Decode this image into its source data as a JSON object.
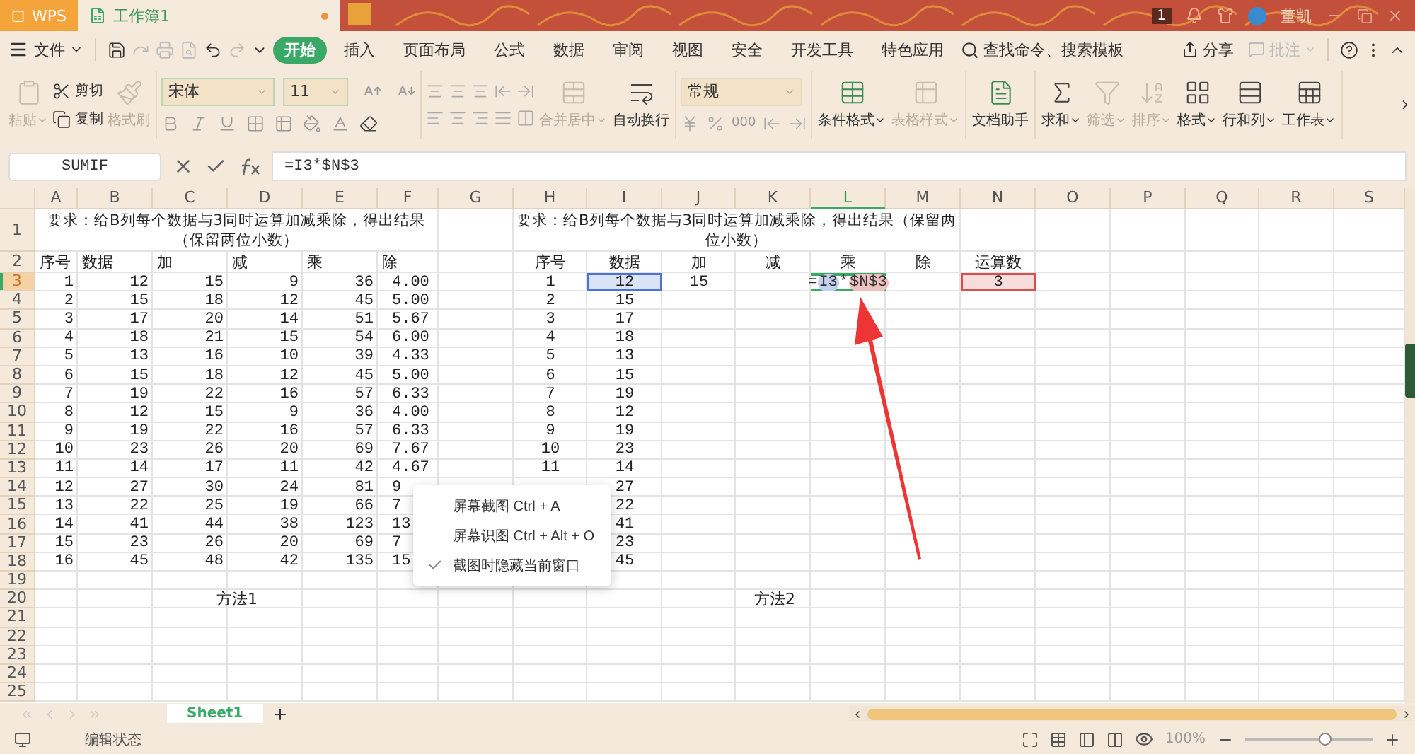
{
  "title_bar": {
    "tabs": [
      {
        "label": "WPS",
        "kind": "home",
        "selected": false
      },
      {
        "label": "工作簿1",
        "kind": "doc",
        "selected": true
      }
    ],
    "badge": "1",
    "user": "董凯"
  },
  "menu": {
    "file": "文件",
    "tabs": [
      {
        "label": "开始",
        "selected": true
      },
      {
        "label": "插入",
        "selected": false
      },
      {
        "label": "页面布局",
        "selected": false
      },
      {
        "label": "公式",
        "selected": false
      },
      {
        "label": "数据",
        "selected": false
      },
      {
        "label": "审阅",
        "selected": false
      },
      {
        "label": "视图",
        "selected": false
      },
      {
        "label": "安全",
        "selected": false
      },
      {
        "label": "开发工具",
        "selected": false
      },
      {
        "label": "特色应用",
        "selected": false
      }
    ],
    "search": "查找命令、搜索模板",
    "share": "分享",
    "comment": {
      "label": "批注",
      "disabled": true
    }
  },
  "ribbon": {
    "groups": [
      [
        {
          "kind": "large",
          "label": "粘贴",
          "dropdown": true,
          "disabled": true
        },
        {
          "kind": "stack",
          "items": [
            {
              "label": "剪切",
              "disabled": false
            },
            {
              "label": "复制",
              "disabled": false
            }
          ]
        },
        {
          "kind": "large",
          "label": "格式刷",
          "dropdown": false,
          "disabled": true
        }
      ],
      [
        {
          "kind": "font",
          "font": "宋体",
          "size": "11"
        }
      ],
      [
        {
          "kind": "align"
        },
        {
          "kind": "large",
          "label": "合并居中",
          "dropdown": true,
          "disabled": true
        },
        {
          "kind": "large",
          "label": "自动换行",
          "dropdown": false,
          "disabled": false
        }
      ],
      [
        {
          "kind": "number",
          "format": "常规",
          "thousands": "000"
        }
      ],
      [
        {
          "kind": "large",
          "label": "条件格式",
          "dropdown": true,
          "disabled": false
        },
        {
          "kind": "large",
          "label": "表格样式",
          "dropdown": true,
          "disabled": true
        }
      ],
      [
        {
          "kind": "large",
          "label": "文档助手",
          "dropdown": false,
          "disabled": false
        }
      ],
      [
        {
          "kind": "large",
          "label": "求和",
          "dropdown": true,
          "disabled": false
        },
        {
          "kind": "large",
          "label": "筛选",
          "dropdown": true,
          "disabled": true
        },
        {
          "kind": "large",
          "label": "排序",
          "dropdown": true,
          "disabled": true
        },
        {
          "kind": "large",
          "label": "格式",
          "dropdown": true,
          "disabled": false
        },
        {
          "kind": "large",
          "label": "行和列",
          "dropdown": true,
          "disabled": false
        },
        {
          "kind": "large",
          "label": "工作表",
          "dropdown": true,
          "disabled": false
        }
      ]
    ]
  },
  "formula_bar": {
    "name_box": "SUMIF",
    "formula": "=I3*$N$3"
  },
  "sheet": {
    "columns": [
      {
        "label": "A",
        "selected": false
      },
      {
        "label": "B",
        "selected": false
      },
      {
        "label": "C",
        "selected": false
      },
      {
        "label": "D",
        "selected": false
      },
      {
        "label": "E",
        "selected": false
      },
      {
        "label": "F",
        "selected": false
      },
      {
        "label": "G",
        "selected": false
      },
      {
        "label": "H",
        "selected": false
      },
      {
        "label": "I",
        "selected": false
      },
      {
        "label": "J",
        "selected": false
      },
      {
        "label": "K",
        "selected": false
      },
      {
        "label": "L",
        "selected": true
      },
      {
        "label": "M",
        "selected": false
      },
      {
        "label": "N",
        "selected": false
      },
      {
        "label": "O",
        "selected": false
      },
      {
        "label": "P",
        "selected": false
      },
      {
        "label": "Q",
        "selected": false
      },
      {
        "label": "R",
        "selected": false
      },
      {
        "label": "S",
        "selected": false
      }
    ],
    "row_numbers": [
      {
        "label": "1",
        "selected": false
      },
      {
        "label": "2",
        "selected": false
      },
      {
        "label": "3",
        "selected": true
      },
      {
        "label": "4",
        "selected": false
      },
      {
        "label": "5",
        "selected": false
      },
      {
        "label": "6",
        "selected": false
      },
      {
        "label": "7",
        "selected": false
      },
      {
        "label": "8",
        "selected": false
      },
      {
        "label": "9",
        "selected": false
      },
      {
        "label": "10",
        "selected": false
      },
      {
        "label": "11",
        "selected": false
      },
      {
        "label": "12",
        "selected": false
      },
      {
        "label": "13",
        "selected": false
      },
      {
        "label": "14",
        "selected": false
      },
      {
        "label": "15",
        "selected": false
      },
      {
        "label": "16",
        "selected": false
      },
      {
        "label": "17",
        "selected": false
      },
      {
        "label": "18",
        "selected": false
      },
      {
        "label": "19",
        "selected": false
      },
      {
        "label": "20",
        "selected": false
      },
      {
        "label": "21",
        "selected": false
      },
      {
        "label": "22",
        "selected": false
      },
      {
        "label": "23",
        "selected": false
      },
      {
        "label": "24",
        "selected": false
      },
      {
        "label": "25",
        "selected": false
      }
    ],
    "left_table": {
      "title": "要求：给B列每个数据与3同时运算加减乘除，得出结果（保留两位小数）",
      "headers": [
        "序号",
        "数据",
        "加",
        "减",
        "乘",
        "除"
      ],
      "rows": [
        [
          "1",
          "12",
          "15",
          "9",
          "36",
          "4.00"
        ],
        [
          "2",
          "15",
          "18",
          "12",
          "45",
          "5.00"
        ],
        [
          "3",
          "17",
          "20",
          "14",
          "51",
          "5.67"
        ],
        [
          "4",
          "18",
          "21",
          "15",
          "54",
          "6.00"
        ],
        [
          "5",
          "13",
          "16",
          "10",
          "39",
          "4.33"
        ],
        [
          "6",
          "15",
          "18",
          "12",
          "45",
          "5.00"
        ],
        [
          "7",
          "19",
          "22",
          "16",
          "57",
          "6.33"
        ],
        [
          "8",
          "12",
          "15",
          "9",
          "36",
          "4.00"
        ],
        [
          "9",
          "19",
          "22",
          "16",
          "57",
          "6.33"
        ],
        [
          "10",
          "23",
          "26",
          "20",
          "69",
          "7.67"
        ],
        [
          "11",
          "14",
          "17",
          "11",
          "42",
          "4.67"
        ],
        [
          "12",
          "27",
          "30",
          "24",
          "81",
          "9"
        ],
        [
          "13",
          "22",
          "25",
          "19",
          "66",
          "7"
        ],
        [
          "14",
          "41",
          "44",
          "38",
          "123",
          "13"
        ],
        [
          "15",
          "23",
          "26",
          "20",
          "69",
          "7"
        ],
        [
          "16",
          "45",
          "48",
          "42",
          "135",
          "15"
        ]
      ],
      "footer": "方法1"
    },
    "right_table": {
      "title": "要求：给B列每个数据与3同时运算加减乘除，得出结果（保留两位小数）",
      "headers": [
        "序号",
        "数据",
        "加",
        "减",
        "乘",
        "除",
        "运算数"
      ],
      "rows": [
        {
          "number": "1",
          "data": "12",
          "data_ref": {
            "color": "#4a72d8"
          },
          "add": "15",
          "formula": {
            "editing": true,
            "parts": [
              {
                "text": "="
              },
              {
                "text": "I3",
                "color": "#c4d0f0"
              },
              {
                "text": "*"
              },
              {
                "text": "$N$3",
                "color": "#efc2c2"
              }
            ]
          },
          "operand": "3",
          "operand_ref": {
            "color": "#d65050"
          }
        },
        {
          "number": "2",
          "data": "15"
        },
        {
          "number": "3",
          "data": "17"
        },
        {
          "number": "4",
          "data": "18"
        },
        {
          "number": "5",
          "data": "13"
        },
        {
          "number": "6",
          "data": "15"
        },
        {
          "number": "7",
          "data": "19"
        },
        {
          "number": "8",
          "data": "12"
        },
        {
          "number": "9",
          "data": "19"
        },
        {
          "number": "10",
          "data": "23"
        },
        {
          "number": "11",
          "data": "14"
        },
        {
          "data": "27"
        },
        {
          "data": "22"
        },
        {
          "data": "41"
        },
        {
          "data": "23"
        },
        {
          "data": "45"
        }
      ],
      "footer": "方法2"
    }
  },
  "context_menu": {
    "items": [
      {
        "label": "屏幕截图 Ctrl + A",
        "checked": false
      },
      {
        "label": "屏幕识图 Ctrl + Alt + O",
        "checked": false
      },
      {
        "label": "截图时隐藏当前窗口",
        "checked": true
      }
    ]
  },
  "sheet_tabs": [
    {
      "label": "Sheet1",
      "selected": true
    }
  ],
  "status_bar": {
    "mode": "编辑状态",
    "zoom": "100%",
    "zoom_slider": {
      "level": 0.62
    }
  }
}
